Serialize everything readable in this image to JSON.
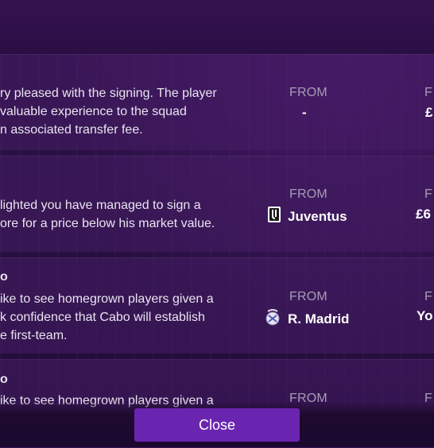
{
  "rows": [
    {
      "heading_fragment": "",
      "lines": [
        "ry pleased with the signing. The player",
        "valuable experience to the squad",
        "n associated transfer fee."
      ],
      "from_label": "FROM",
      "from_value": "-",
      "col2_label_fragment": "F",
      "col2_value_fragment": "£"
    },
    {
      "heading_fragment": "",
      "lines": [
        "lighted you have managed to sign a",
        "ore for a price below his market value."
      ],
      "from_label": "FROM",
      "from_value": "Juventus",
      "from_icon": "juventus-crest-icon",
      "col2_label_fragment": "F",
      "col2_value_fragment": "£6"
    },
    {
      "heading_fragment": "o",
      "lines": [
        "ike to see homegrown players given a",
        "k confidence that Cabo will establish",
        "e first-team."
      ],
      "from_label": "FROM",
      "from_value": "R. Madrid",
      "from_icon": "real-madrid-crest-icon",
      "col2_label_fragment": "F",
      "col2_value_fragment": "Yo"
    },
    {
      "heading_fragment": "o",
      "lines": [
        "ike to see homegrown players given a"
      ],
      "from_label": "FROM",
      "col2_label_fragment": "F"
    }
  ],
  "footer": {
    "close_label": "Close"
  },
  "colors": {
    "accent": "#6a25b0",
    "background": "#2a0f40"
  }
}
